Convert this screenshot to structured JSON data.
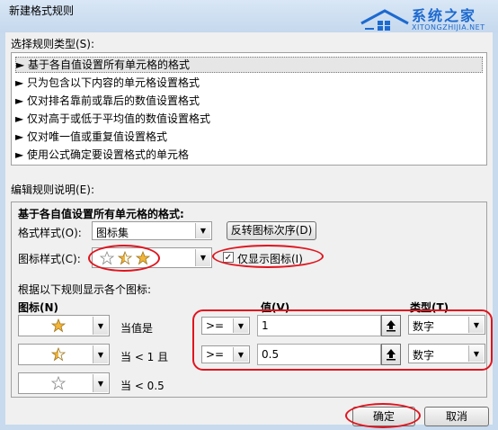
{
  "window": {
    "title": "新建格式规则"
  },
  "watermark": {
    "name": "系统之家",
    "url": "XITONGZHIJIA.NET"
  },
  "rule_type_section": {
    "label": "选择规则类型(S):"
  },
  "rule_types": [
    "► 基于各自值设置所有单元格的格式",
    "► 只为包含以下内容的单元格设置格式",
    "► 仅对排名靠前或靠后的数值设置格式",
    "► 仅对高于或低于平均值的数值设置格式",
    "► 仅对唯一值或重复值设置格式",
    "► 使用公式确定要设置格式的单元格"
  ],
  "edit_section": {
    "label": "编辑规则说明(E):"
  },
  "desc": {
    "heading": "基于各自值设置所有单元格的格式:",
    "format_style_label": "格式样式(O):",
    "format_style_value": "图标集",
    "reverse_button": "反转图标次序(D)",
    "icon_style_label": "图标样式(C):",
    "show_icon_only_label": "仅显示图标(I)",
    "show_icon_only_checked": true,
    "rules_caption": "根据以下规则显示各个图标:",
    "col_icon": "图标(N)",
    "col_value": "值(V)",
    "col_type": "类型(T)"
  },
  "icon_rules": [
    {
      "icon": "star-full-icon",
      "condition": "当值是",
      "operator": ">=",
      "value": "1",
      "type": "数字"
    },
    {
      "icon": "star-half-icon",
      "condition": "当 < 1 且",
      "operator": ">=",
      "value": "0.5",
      "type": "数字"
    },
    {
      "icon": "star-empty-icon",
      "condition": "当 < 0.5"
    }
  ],
  "footer": {
    "ok": "确定",
    "cancel": "取消"
  },
  "colors": {
    "highlight": "#e0141e",
    "star": "#f2b53a"
  }
}
